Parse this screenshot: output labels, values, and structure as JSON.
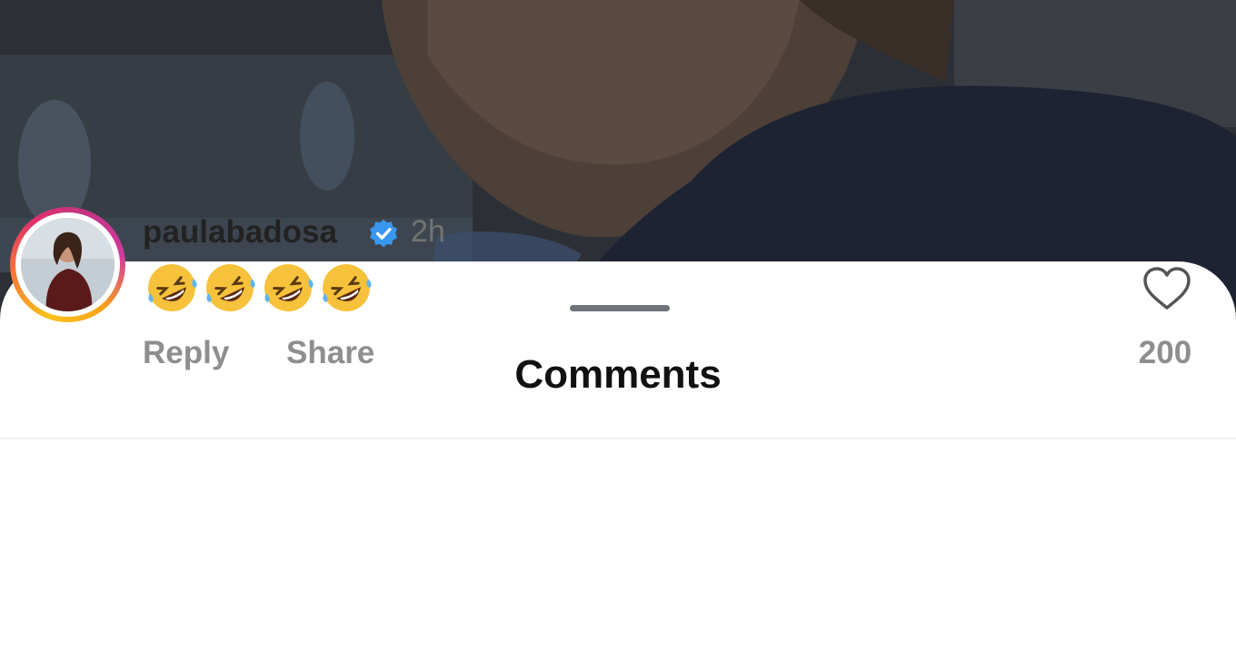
{
  "sheet": {
    "title": "Comments"
  },
  "comment": {
    "username": "paulabadosa",
    "time": "2h",
    "text": "🤣🤣🤣🤣",
    "reply_label": "Reply",
    "share_label": "Share",
    "likes": "200"
  },
  "colors": {
    "verified": "#3897f0",
    "secondary_text": "#8e8e8e",
    "grabber": "#6f747a"
  },
  "icons": [
    "verified-badge-icon",
    "heart-icon",
    "rofl-emoji"
  ]
}
